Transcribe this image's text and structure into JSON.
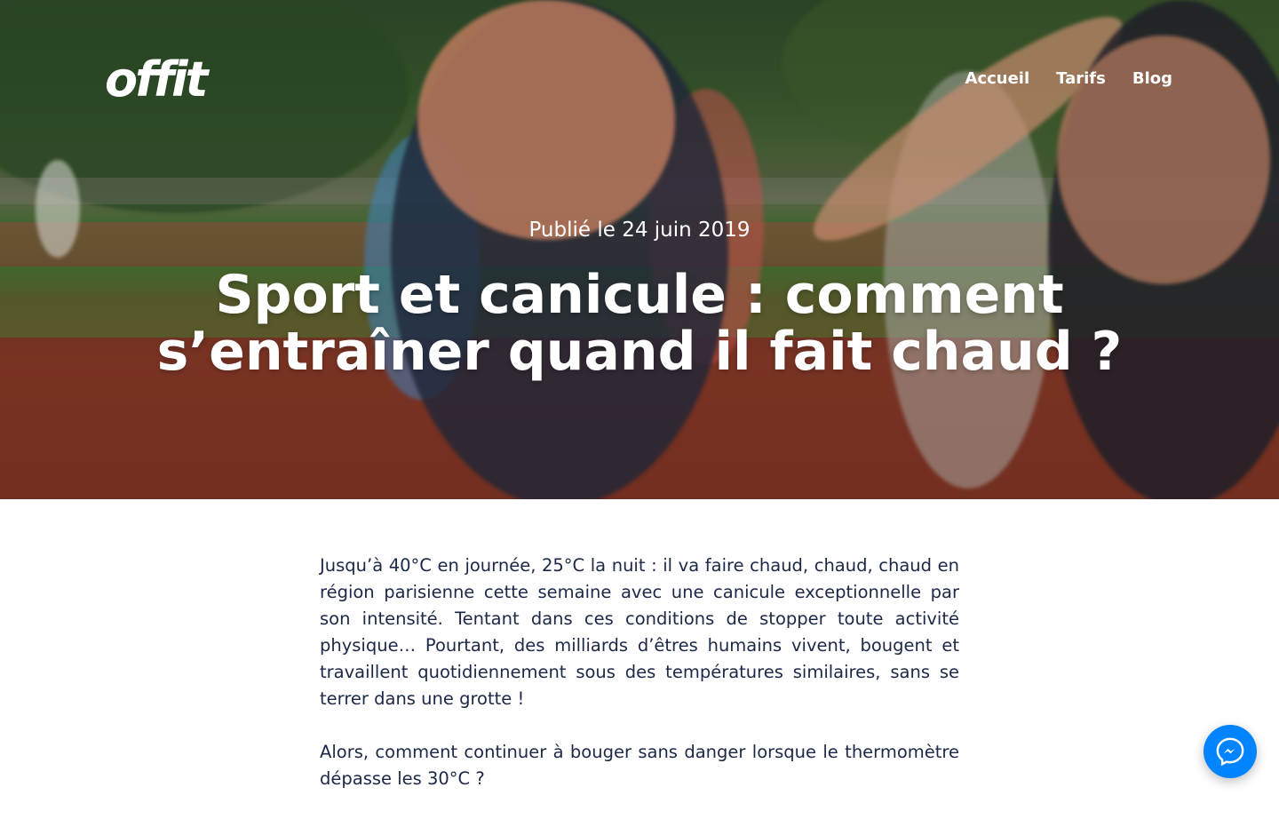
{
  "header": {
    "logo_text": "offit",
    "nav": [
      {
        "label": "Accueil"
      },
      {
        "label": "Tarifs"
      },
      {
        "label": "Blog"
      }
    ]
  },
  "hero": {
    "published": "Publié le 24 juin 2019",
    "title": "Sport et canicule : comment s’entraîner quand il fait chaud ?"
  },
  "article": {
    "paragraphs": [
      "Jusqu’à 40°C en journée, 25°C la nuit : il va faire chaud, chaud, chaud en région parisienne cette semaine avec une canicule exceptionnelle par son intensité. Tentant dans ces conditions de stopper toute activité physique… Pourtant, des milliards d’êtres humains vivent, bougent et travaillent quotidiennement sous des températures similaires, sans se terrer dans une grotte !",
      "Alors, comment continuer à bouger sans danger lorsque le thermomètre dépasse les 30°C ?"
    ]
  },
  "chat": {
    "icon": "messenger-icon",
    "color": "#0084ff"
  },
  "colors": {
    "text": "#1c2848",
    "hero_text": "#ffffff"
  }
}
